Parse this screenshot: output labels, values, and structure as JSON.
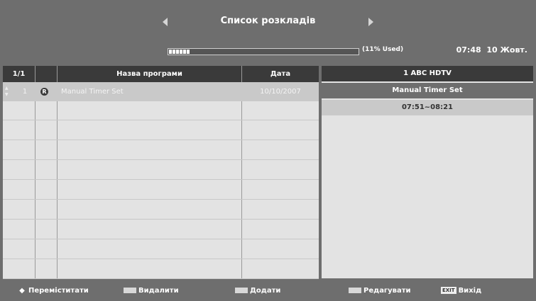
{
  "header": {
    "title": "Список розкладів",
    "usage_label": "(11% Used)",
    "usage_percent": 11,
    "time": "07:48",
    "date": "10 Жовт."
  },
  "table": {
    "page": "1/1",
    "columns": [
      "Назва програми",
      "Дата"
    ],
    "rows": [
      {
        "num": "1",
        "badge": "R",
        "name": "Manual Timer Set",
        "date": "10/10/2007"
      }
    ],
    "empty_rows": 9
  },
  "detail": {
    "channel": "1 ABC HDTV",
    "program": "Manual Timer Set",
    "time_range": "07:51~08:21"
  },
  "footer": {
    "move": "Переміститати",
    "delete": "Видалити",
    "add": "Додати",
    "edit": "Редагувати",
    "exit_key": "EXIT",
    "exit": "Вихід"
  },
  "colors": {
    "header_bar": "#3a3a3a",
    "selected_row": "#c9c9c9",
    "table_bg": "#e3e3e3"
  }
}
